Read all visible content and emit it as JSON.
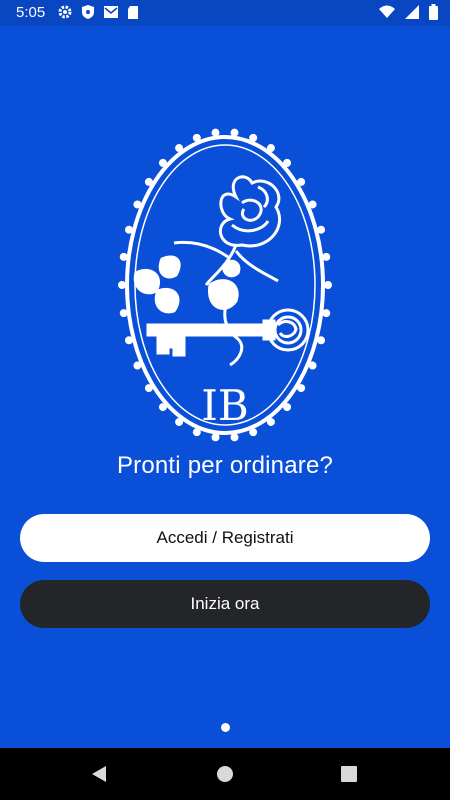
{
  "status_bar": {
    "time": "5:05",
    "left_icons": [
      "gear-icon",
      "shield-icon",
      "gmail-icon",
      "sd-card-icon"
    ],
    "right_icons": [
      "wifi-icon",
      "signal-icon",
      "battery-icon"
    ]
  },
  "logo": {
    "monogram": "IB",
    "description_icons": [
      "rose-icon",
      "key-icon"
    ]
  },
  "main": {
    "title": "Pronti per ordinare?",
    "login_button": "Accedi / Registrati",
    "start_button": "Inizia ora"
  },
  "pager": {
    "pages": 1,
    "active": 1
  },
  "nav_bar": {
    "icons": [
      "back-icon",
      "home-icon",
      "recents-icon"
    ]
  },
  "colors": {
    "background": "#0a4fd8",
    "status_bar": "#0846c2",
    "primary_button": "#ffffff",
    "secondary_button": "#232529"
  }
}
